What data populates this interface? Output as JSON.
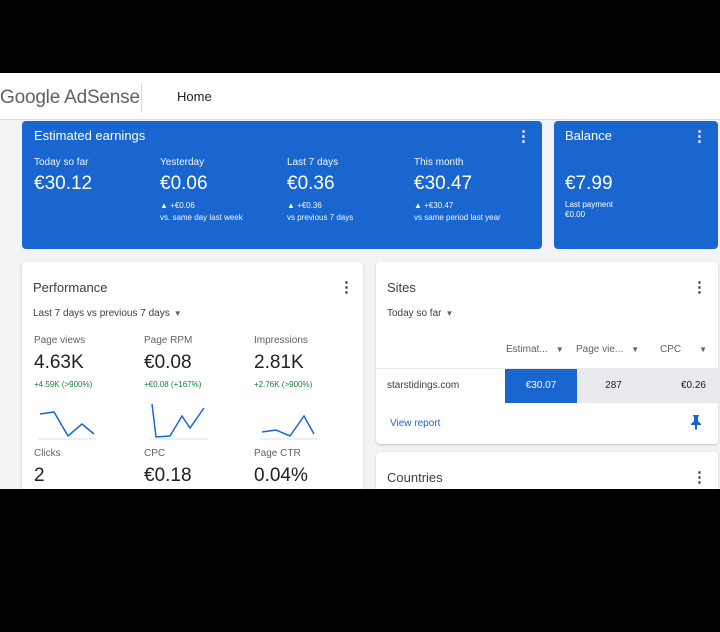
{
  "app": {
    "logo": "Google AdSense",
    "nav_home": "Home"
  },
  "earnings": {
    "title": "Estimated earnings",
    "columns": [
      {
        "label": "Today so far",
        "value": "€30.12",
        "change": "",
        "comparison": ""
      },
      {
        "label": "Yesterday",
        "value": "€0.06",
        "change": "▲ +€0.06",
        "comparison": "vs. same day last week"
      },
      {
        "label": "Last 7 days",
        "value": "€0.36",
        "change": "▲ +€0.36",
        "comparison": "vs previous 7 days"
      },
      {
        "label": "This month",
        "value": "€30.47",
        "change": "▲ +€30.47",
        "comparison": "vs same period last year"
      }
    ]
  },
  "balance": {
    "title": "Balance",
    "value": "€7.99",
    "last_payment_label": "Last payment",
    "last_payment_value": "€0.00"
  },
  "performance": {
    "title": "Performance",
    "range": "Last 7 days vs previous 7 days",
    "metrics": [
      {
        "label": "Page views",
        "value": "4.63K",
        "change": "+4.59K (>900%)"
      },
      {
        "label": "Page RPM",
        "value": "€0.08",
        "change": "+€0.08 (+167%)"
      },
      {
        "label": "Impressions",
        "value": "2.81K",
        "change": "+2.76K (>900%)"
      },
      {
        "label": "Clicks",
        "value": "2",
        "change": ""
      },
      {
        "label": "CPC",
        "value": "€0.18",
        "change": ""
      },
      {
        "label": "Page CTR",
        "value": "0.04%",
        "change": ""
      }
    ]
  },
  "sites": {
    "title": "Sites",
    "range": "Today so far",
    "columns": [
      "Estimat...",
      "Page vie...",
      "CPC"
    ],
    "rows": [
      {
        "site": "starstidings.com",
        "earnings": "€30.07",
        "page_views": "287",
        "cpc": "€0.26"
      }
    ],
    "view_report": "View report"
  },
  "countries": {
    "title": "Countries"
  },
  "colors": {
    "accent": "#1a66d0",
    "positive": "#188038",
    "background": "#f1f3f4"
  },
  "icons": {
    "menu": "more-vert-icon",
    "pin": "pin-icon",
    "dropdown": "dropdown-caret-icon"
  }
}
